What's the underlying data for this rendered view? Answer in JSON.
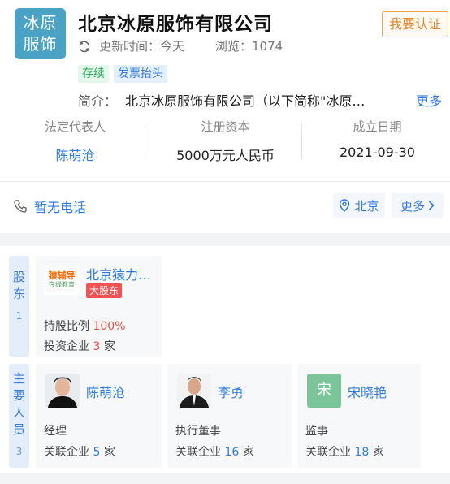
{
  "company": {
    "logo_line1": "冰原",
    "logo_line2": "服饰",
    "name": "北京冰原服饰有限公司",
    "cert_button": "我要认证",
    "updated": "更新时间：今天",
    "views": "浏览：1074",
    "tags": [
      "存续",
      "发票抬头"
    ],
    "intro_label": "简介：",
    "intro_text": "北京冰原服饰有限公司（以下简称\"冰原…",
    "intro_more": "更多"
  },
  "stats": [
    {
      "label": "法定代表人",
      "value": "陈萌沧"
    },
    {
      "label": "注册资本",
      "value": "5000万元人民币"
    },
    {
      "label": "成立日期",
      "value": "2021-09-30"
    }
  ],
  "contact": {
    "phone": "暂无电话",
    "city": "北京",
    "more": "更多"
  },
  "shareholders": {
    "tab_label": "股东",
    "tab_count": "1",
    "items": [
      {
        "logo_top": "猿辅导",
        "logo_bottom": "在线教育",
        "name": "北京猿力…",
        "badge": "大股东",
        "ratio_label": "持股比例",
        "ratio_value": "100%",
        "invest_prefix": "投资企业",
        "invest_count": "3",
        "invest_suffix": "家"
      }
    ]
  },
  "people": {
    "tab_label": "主要人员",
    "tab_count": "3",
    "items": [
      {
        "name": "陈萌沧",
        "role": "经理",
        "rel_prefix": "关联企业",
        "rel_count": "5",
        "rel_suffix": "家"
      },
      {
        "name": "李勇",
        "role": "执行董事",
        "rel_prefix": "关联企业",
        "rel_count": "16",
        "rel_suffix": "家"
      },
      {
        "name": "宋晓艳",
        "avatar_char": "宋",
        "role": "监事",
        "rel_prefix": "关联企业",
        "rel_count": "18",
        "rel_suffix": "家"
      }
    ]
  }
}
